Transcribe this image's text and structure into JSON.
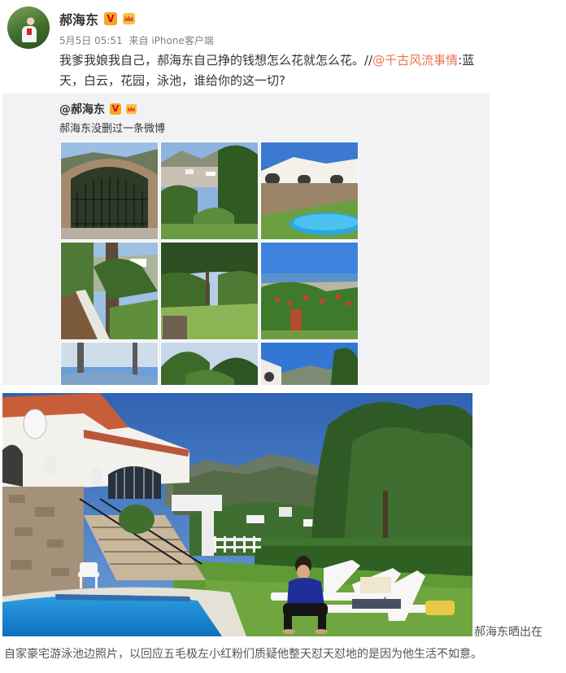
{
  "post": {
    "author": "郝海东",
    "verified_badge": "V",
    "timestamp": "5月5日 05:51",
    "source": "来自 iPhone客户端",
    "text_before_mention": "我爹我娘我自己，郝海东自己挣的钱想怎么花就怎么花。//",
    "mention": "@千古风流事情",
    "text_after_mention": ":蓝天，白云，花园，泳池，谁给你的这一切?",
    "accent_color": "#eb7350"
  },
  "repost": {
    "author": "@郝海东",
    "verified_badge": "V",
    "text": "郝海东没删过一条微博"
  },
  "photo_grid": {
    "count": 9
  },
  "caption": {
    "line1": "郝海东晒出在",
    "line2": "自家豪宅游泳池边照片，以回应五毛极左小红粉们质疑他整天怼天怼地的是因为他生活不如意。"
  }
}
